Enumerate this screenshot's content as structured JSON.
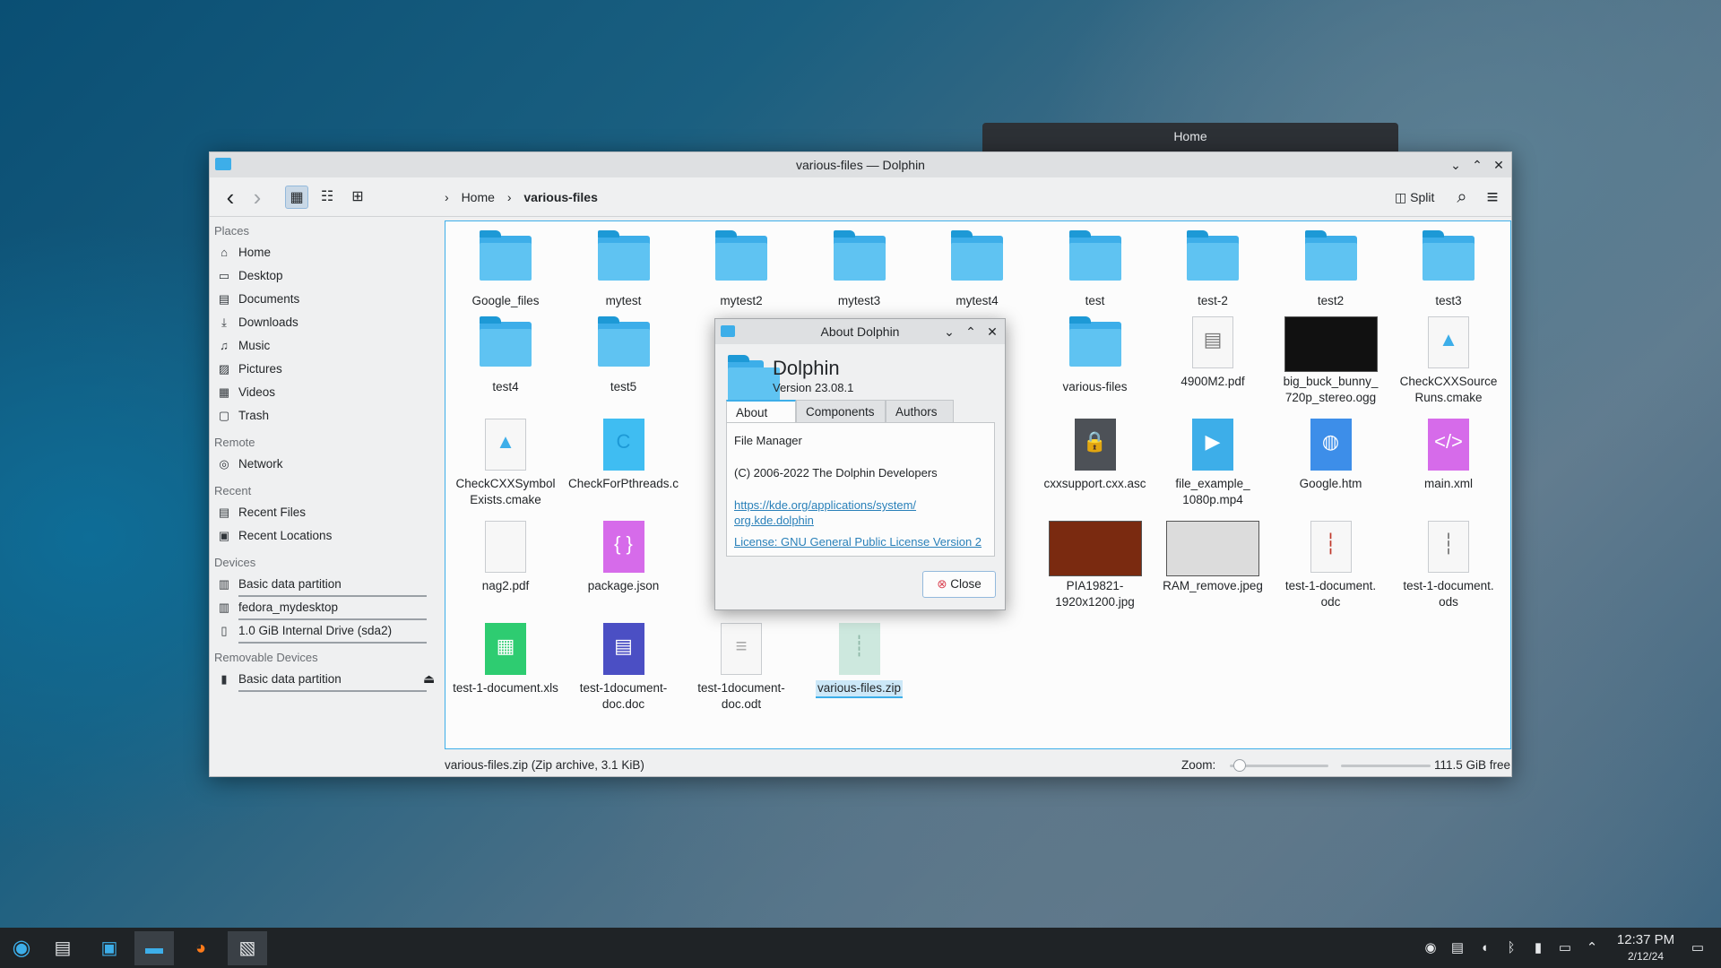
{
  "background_window": {
    "title": "Home"
  },
  "window": {
    "title": "various-files — Dolphin",
    "controls": {
      "minimize": "⌄",
      "maximize": "⌃",
      "close": "✕"
    }
  },
  "toolbar": {
    "back": "‹",
    "forward": "›",
    "breadcrumb": [
      "Home",
      "various-files"
    ],
    "breadcrumb_sep": "›",
    "split_label": "Split",
    "search_icon": "⌕",
    "menu_icon": "≡"
  },
  "sidebar": {
    "sections": [
      {
        "title": "Places",
        "items": [
          {
            "label": "Home",
            "icon": "home-icon",
            "glyph": "⌂"
          },
          {
            "label": "Desktop",
            "icon": "desktop-icon",
            "glyph": "▭"
          },
          {
            "label": "Documents",
            "icon": "documents-icon",
            "glyph": "▤"
          },
          {
            "label": "Downloads",
            "icon": "downloads-icon",
            "glyph": "⤓"
          },
          {
            "label": "Music",
            "icon": "music-icon",
            "glyph": "♫"
          },
          {
            "label": "Pictures",
            "icon": "pictures-icon",
            "glyph": "▨"
          },
          {
            "label": "Videos",
            "icon": "videos-icon",
            "glyph": "▦"
          },
          {
            "label": "Trash",
            "icon": "trash-icon",
            "glyph": "▢"
          }
        ]
      },
      {
        "title": "Remote",
        "items": [
          {
            "label": "Network",
            "icon": "network-icon",
            "glyph": "◎"
          }
        ]
      },
      {
        "title": "Recent",
        "items": [
          {
            "label": "Recent Files",
            "icon": "recent-files-icon",
            "glyph": "▤"
          },
          {
            "label": "Recent Locations",
            "icon": "recent-locations-icon",
            "glyph": "▣"
          }
        ]
      },
      {
        "title": "Devices",
        "items": [
          {
            "label": "Basic data partition",
            "icon": "drive-icon",
            "glyph": "▥"
          },
          {
            "label": "fedora_mydesktop",
            "icon": "drive-icon",
            "glyph": "▥"
          },
          {
            "label": "1.0 GiB Internal Drive (sda2)",
            "icon": "drive-icon",
            "glyph": "▯"
          }
        ]
      },
      {
        "title": "Removable Devices",
        "items": [
          {
            "label": "Basic data partition",
            "icon": "usb-drive-icon",
            "glyph": "▮"
          }
        ]
      }
    ],
    "eject_icon": "⏏"
  },
  "files": [
    {
      "name": "Google_files",
      "kind": "folder"
    },
    {
      "name": "mytest",
      "kind": "folder"
    },
    {
      "name": "mytest2",
      "kind": "folder"
    },
    {
      "name": "mytest3",
      "kind": "folder"
    },
    {
      "name": "mytest4",
      "kind": "folder"
    },
    {
      "name": "test",
      "kind": "folder"
    },
    {
      "name": "test-2",
      "kind": "folder"
    },
    {
      "name": "test2",
      "kind": "folder"
    },
    {
      "name": "test3",
      "kind": "folder"
    },
    {
      "name": "test4",
      "kind": "folder"
    },
    {
      "name": "test5",
      "kind": "folder"
    },
    {
      "name": "various-files",
      "kind": "folder"
    },
    {
      "name": "4900M2.pdf",
      "kind": "doc",
      "glyph": "▤",
      "color": "#777777"
    },
    {
      "name": "big_buck_bunny_ 720p_stereo.ogg",
      "kind": "thumb",
      "color": "#111111"
    },
    {
      "name": "CheckCXXSource Runs.cmake",
      "kind": "doc",
      "glyph": "▲",
      "color": "#3daee9"
    },
    {
      "name": "CheckCXXSymbol Exists.cmake",
      "kind": "doc",
      "glyph": "▲",
      "color": "#3daee9"
    },
    {
      "name": "CheckForPthreads.c",
      "kind": "doc",
      "glyph": "C",
      "color": "#1d99d6",
      "fill": "#3fbdf2"
    },
    {
      "name": "cxxsupport.cxx.asc",
      "kind": "doc",
      "glyph": "🔒",
      "color": "#ffffff",
      "fill": "#4d5157"
    },
    {
      "name": "file_example_ 1080p.mp4",
      "kind": "doc",
      "glyph": "▶",
      "color": "#ffffff",
      "fill": "#3daee9"
    },
    {
      "name": "Google.htm",
      "kind": "doc",
      "glyph": "◍",
      "color": "#ffffff",
      "fill": "#3d8ee9"
    },
    {
      "name": "main.xml",
      "kind": "doc",
      "glyph": "</>",
      "color": "#ffffff",
      "fill": "#d66bea"
    },
    {
      "name": "nag2.pdf",
      "kind": "doc",
      "glyph": "",
      "color": "#777777"
    },
    {
      "name": "package.json",
      "kind": "doc",
      "glyph": "{ }",
      "color": "#ffffff",
      "fill": "#d66bea"
    },
    {
      "name": "PIA19821- 1920x1200.jpg",
      "kind": "thumb",
      "color": "#7a2a10"
    },
    {
      "name": "RAM_remove.jpeg",
      "kind": "thumb",
      "color": "#dcdcdc"
    },
    {
      "name": "test-1-document. odc",
      "kind": "doc",
      "glyph": "┆",
      "color": "#c0392b"
    },
    {
      "name": "test-1-document. ods",
      "kind": "doc",
      "glyph": "┆",
      "color": "#777777"
    },
    {
      "name": "test-1-document.xls",
      "kind": "doc",
      "glyph": "▦",
      "color": "#ffffff",
      "fill": "#2ecc71"
    },
    {
      "name": "test-1document- doc.doc",
      "kind": "doc",
      "glyph": "▤",
      "color": "#ffffff",
      "fill": "#4b4fc4"
    },
    {
      "name": "test-1document- doc.odt",
      "kind": "doc",
      "glyph": "≡",
      "color": "#aaaaaa"
    },
    {
      "name": "various-files.zip",
      "kind": "doc",
      "glyph": "┊",
      "color": "#8fb8a8",
      "fill": "#cde8de",
      "selected": true
    }
  ],
  "statusbar": {
    "info": "various-files.zip (Zip archive, 3.1 KiB)",
    "zoom_label": "Zoom:",
    "free_space": "111.5 GiB free"
  },
  "about": {
    "title": "About Dolphin",
    "app_name": "Dolphin",
    "version": "Version 23.08.1",
    "tabs": [
      "About",
      "Components",
      "Authors"
    ],
    "description": "File Manager",
    "copyright": "(C) 2006-2022 The Dolphin Developers",
    "link_line1": "https://kde.org/applications/system/",
    "link_line2": "org.kde.dolphin",
    "license": "License: GNU General Public License Version 2",
    "close_label": "Close"
  },
  "taskbar": {
    "clock_time": "12:37 PM",
    "clock_date": "2/12/24"
  },
  "colors": {
    "accent": "#3daee9",
    "folder": "#5fc3f2",
    "taskbar": "#1f2326"
  }
}
